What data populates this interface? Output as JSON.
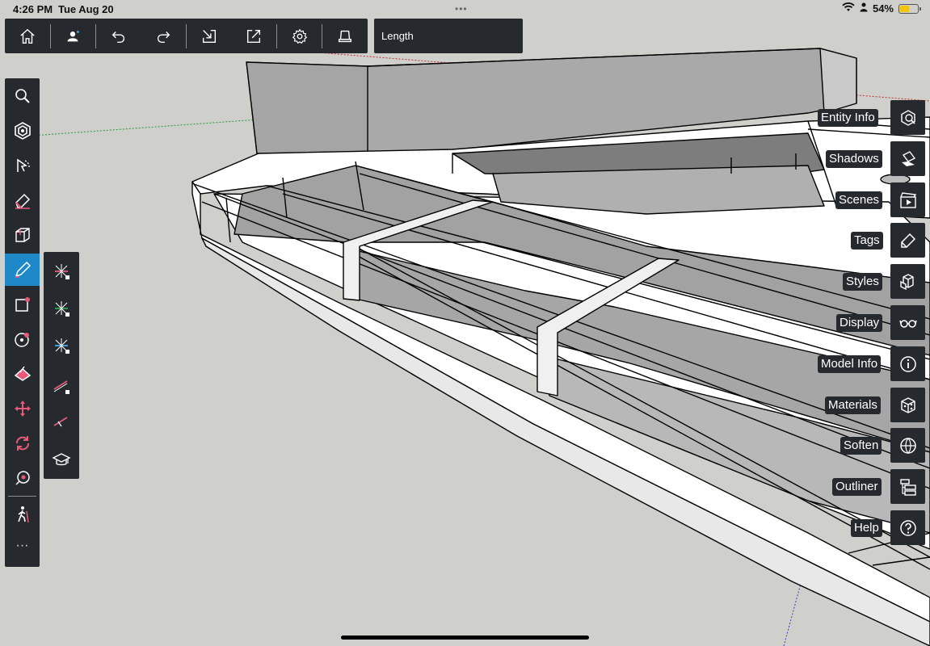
{
  "status_bar": {
    "time": "4:26 PM",
    "date": "Tue Aug 20",
    "dots": "•••",
    "battery_percent": "54%",
    "battery_level": 0.54
  },
  "top_toolbar": {
    "buttons": [
      "home-icon",
      "profile-icon",
      "undo-icon",
      "redo-icon",
      "import-icon",
      "export-icon",
      "settings-icon",
      "display-stand-icon"
    ]
  },
  "vcb": {
    "label": "Length"
  },
  "left_toolbar": {
    "tools": [
      "search-icon",
      "select-icon",
      "orbit-icon",
      "eraser-icon",
      "push-pull-icon",
      "pencil-icon",
      "rectangle-icon",
      "circle-icon",
      "paint-bucket-icon",
      "move-icon",
      "rotate-icon",
      "tape-measure-icon",
      "walk-icon"
    ],
    "active_tool": "pencil-icon",
    "more_label": "···"
  },
  "sub_toolbar": {
    "tools": [
      "lock-red-axis-icon",
      "lock-green-axis-icon",
      "lock-blue-axis-icon",
      "lock-inference-icon",
      "inference-line-icon",
      "learn-icon"
    ]
  },
  "right_panel": {
    "items": [
      {
        "label": "Entity Info",
        "icon": "entity-info-icon"
      },
      {
        "label": "Shadows",
        "icon": "shadows-icon"
      },
      {
        "label": "Scenes",
        "icon": "scenes-icon"
      },
      {
        "label": "Tags",
        "icon": "tags-icon"
      },
      {
        "label": "Styles",
        "icon": "styles-icon"
      },
      {
        "label": "Display",
        "icon": "display-icon"
      },
      {
        "label": "Model Info",
        "icon": "model-info-icon"
      },
      {
        "label": "Materials",
        "icon": "materials-icon"
      },
      {
        "label": "Soften",
        "icon": "soften-icon"
      },
      {
        "label": "Outliner",
        "icon": "outliner-icon"
      },
      {
        "label": "Help",
        "icon": "help-icon"
      }
    ]
  },
  "colors": {
    "toolbar_bg": "#262a2e",
    "active_tool": "#1e88c8",
    "viewport_bg": "#cfcfcb",
    "accent_pink": "#e8587a"
  }
}
